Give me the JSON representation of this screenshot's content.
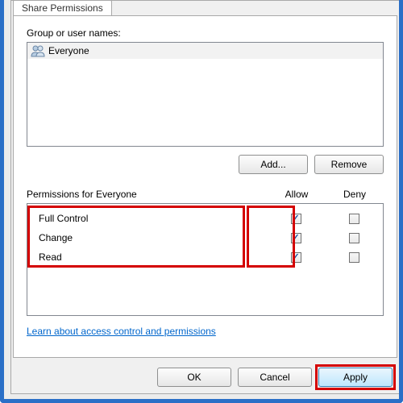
{
  "tab": {
    "label": "Share Permissions"
  },
  "groups": {
    "label": "Group or user names:",
    "items": [
      {
        "name": "Everyone"
      }
    ]
  },
  "buttons": {
    "add": "Add...",
    "remove": "Remove",
    "ok": "OK",
    "cancel": "Cancel",
    "apply": "Apply"
  },
  "permissions": {
    "header_label": "Permissions for Everyone",
    "col_allow": "Allow",
    "col_deny": "Deny",
    "rows": [
      {
        "name": "Full Control",
        "allow": true,
        "deny": false
      },
      {
        "name": "Change",
        "allow": true,
        "deny": false
      },
      {
        "name": "Read",
        "allow": true,
        "deny": false
      }
    ]
  },
  "link": {
    "text": "Learn about access control and permissions"
  }
}
